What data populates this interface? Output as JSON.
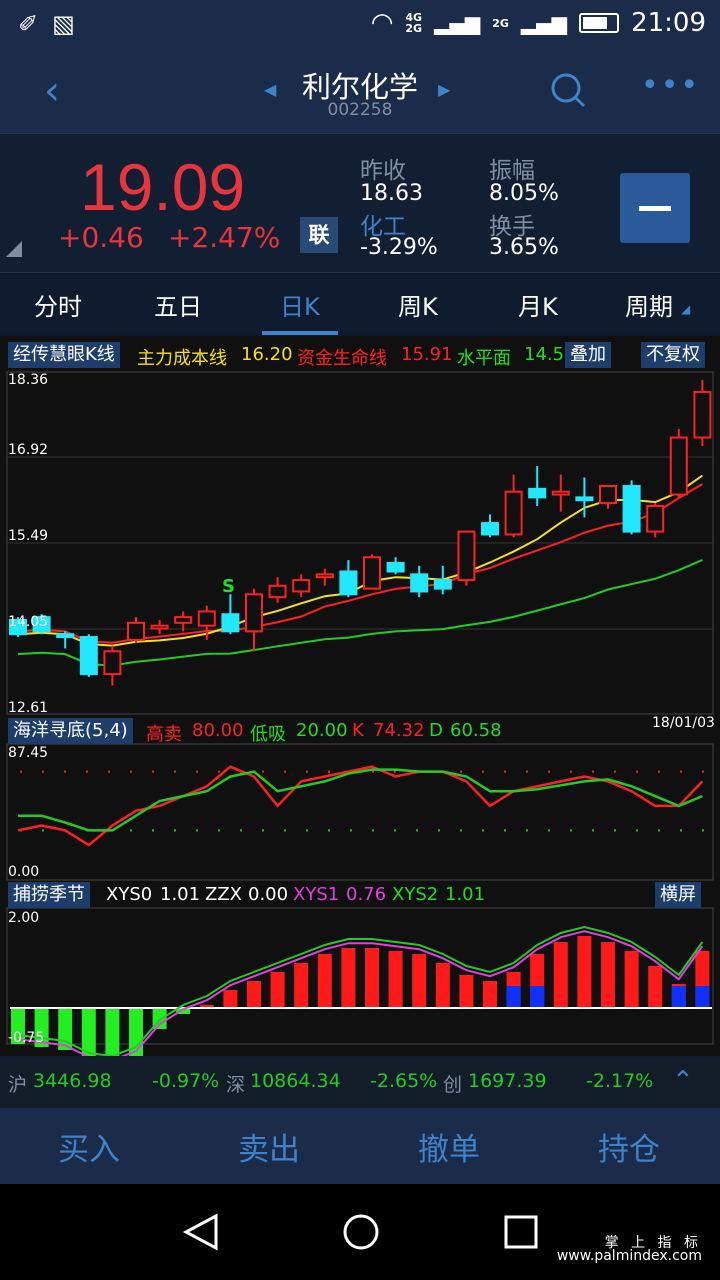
{
  "status": {
    "time": "21:09",
    "net1": "4G",
    "net2": "2G",
    "net3": "2G"
  },
  "nav": {
    "title": "利尔化学",
    "code": "002258"
  },
  "quote": {
    "price": "19.09",
    "change": "+0.46",
    "change_pct": "+2.47%",
    "prev_close_label": "昨收",
    "prev_close": "18.63",
    "amplitude_label": "振幅",
    "amplitude": "8.05%",
    "sector_label": "化工",
    "sector_change": "-3.29%",
    "turnover_label": "换手",
    "turnover": "3.65%",
    "lian_label": "联"
  },
  "tabs": [
    "分时",
    "五日",
    "日K",
    "周K",
    "月K",
    "周期"
  ],
  "main_chart": {
    "name": "经传慧眼K线",
    "ind1_label": "主力成本线",
    "ind1_value": "16.20",
    "ind2_label": "资金生命线",
    "ind2_value": "15.91",
    "ind3_label": "水平面",
    "ind3_value": "14.5",
    "overlay_btn": "叠加",
    "adjust_btn": "不复权",
    "y_ticks": [
      "18.36",
      "16.92",
      "15.49",
      "14.05",
      "12.61"
    ],
    "date": "18/01/03",
    "signal": "S"
  },
  "sub1": {
    "name": "海洋寻底(5,4)",
    "sell_label": "高卖",
    "sell_value": "80.00",
    "buy_label": "低吸",
    "buy_value": "20.00",
    "k_label": "K",
    "k_value": "74.32",
    "d_label": "D",
    "d_value": "60.58",
    "y_top": "87.45",
    "y_bottom": "0.00"
  },
  "sub2": {
    "name": "捕捞季节",
    "xys0_label": "XYS0",
    "xys0_value": "1.01",
    "zzx_label": "ZZX",
    "zzx_value": "0.00",
    "xys1_label": "XYS1",
    "xys1_value": "0.76",
    "xys2_label": "XYS2",
    "xys2_value": "1.01",
    "landscape_btn": "横屏",
    "y_top": "2.00",
    "y_bottom": "-0.75"
  },
  "ticker": {
    "sh_label": "沪",
    "sh_value": "3446.98",
    "sh_pct": "-0.97%",
    "sz_label": "深",
    "sz_value": "10864.34",
    "sz_pct": "-2.65%",
    "cy_label": "创",
    "cy_value": "1697.39",
    "cy_pct": "-2.17%"
  },
  "actions": {
    "buy": "买入",
    "sell": "卖出",
    "cancel": "撤单",
    "position": "持仓"
  },
  "watermark": {
    "line1": "掌 上 指 标",
    "line2": "www.palmindex.com"
  },
  "candles": [
    {
      "o": 14.15,
      "c": 13.9,
      "h": 14.2,
      "l": 13.85
    },
    {
      "o": 14.2,
      "c": 13.95,
      "h": 14.25,
      "l": 13.9
    },
    {
      "o": 13.9,
      "c": 13.85,
      "h": 13.95,
      "l": 13.65
    },
    {
      "o": 13.85,
      "c": 13.2,
      "h": 13.9,
      "l": 13.15
    },
    {
      "o": 13.2,
      "c": 13.6,
      "h": 13.7,
      "l": 13.0
    },
    {
      "o": 13.8,
      "c": 14.1,
      "h": 14.2,
      "l": 13.75
    },
    {
      "o": 14.0,
      "c": 14.05,
      "h": 14.15,
      "l": 13.9
    },
    {
      "o": 14.1,
      "c": 14.2,
      "h": 14.3,
      "l": 13.95
    },
    {
      "o": 14.05,
      "c": 14.3,
      "h": 14.4,
      "l": 13.8
    },
    {
      "o": 14.25,
      "c": 13.95,
      "h": 14.6,
      "l": 13.9
    },
    {
      "o": 13.95,
      "c": 14.6,
      "h": 14.7,
      "l": 13.6
    },
    {
      "o": 14.55,
      "c": 14.75,
      "h": 14.9,
      "l": 14.45
    },
    {
      "o": 14.65,
      "c": 14.85,
      "h": 14.95,
      "l": 14.55
    },
    {
      "o": 14.9,
      "c": 14.95,
      "h": 15.05,
      "l": 14.75
    },
    {
      "o": 15.0,
      "c": 14.6,
      "h": 15.2,
      "l": 14.55
    },
    {
      "o": 14.7,
      "c": 15.25,
      "h": 15.3,
      "l": 14.7
    },
    {
      "o": 15.15,
      "c": 15.0,
      "h": 15.25,
      "l": 14.95
    },
    {
      "o": 14.95,
      "c": 14.65,
      "h": 15.1,
      "l": 14.55
    },
    {
      "o": 14.85,
      "c": 14.7,
      "h": 15.1,
      "l": 14.6
    },
    {
      "o": 14.85,
      "c": 15.7,
      "h": 15.7,
      "l": 14.75
    },
    {
      "o": 15.85,
      "c": 15.65,
      "h": 16.0,
      "l": 15.6
    },
    {
      "o": 15.65,
      "c": 16.4,
      "h": 16.7,
      "l": 15.6
    },
    {
      "o": 16.45,
      "c": 16.3,
      "h": 16.85,
      "l": 16.15
    },
    {
      "o": 16.35,
      "c": 16.4,
      "h": 16.7,
      "l": 16.05
    },
    {
      "o": 16.3,
      "c": 16.25,
      "h": 16.65,
      "l": 15.95
    },
    {
      "o": 16.2,
      "c": 16.5,
      "h": 16.5,
      "l": 16.1
    },
    {
      "o": 16.5,
      "c": 15.7,
      "h": 16.6,
      "l": 15.65
    },
    {
      "o": 15.7,
      "c": 16.15,
      "h": 16.2,
      "l": 15.6
    },
    {
      "o": 16.35,
      "c": 17.35,
      "h": 17.5,
      "l": 16.3
    },
    {
      "o": 17.35,
      "c": 18.15,
      "h": 18.36,
      "l": 17.2
    }
  ],
  "kd": {
    "k": [
      20,
      25,
      20,
      5,
      25,
      40,
      45,
      55,
      65,
      85,
      75,
      45,
      70,
      75,
      80,
      85,
      75,
      80,
      80,
      70,
      45,
      60,
      65,
      70,
      75,
      70,
      60,
      45,
      45,
      70
    ],
    "d": [
      35,
      35,
      28,
      20,
      20,
      35,
      50,
      55,
      60,
      75,
      80,
      60,
      65,
      70,
      78,
      82,
      82,
      80,
      80,
      75,
      60,
      60,
      62,
      66,
      70,
      72,
      65,
      55,
      45,
      55
    ]
  }
}
